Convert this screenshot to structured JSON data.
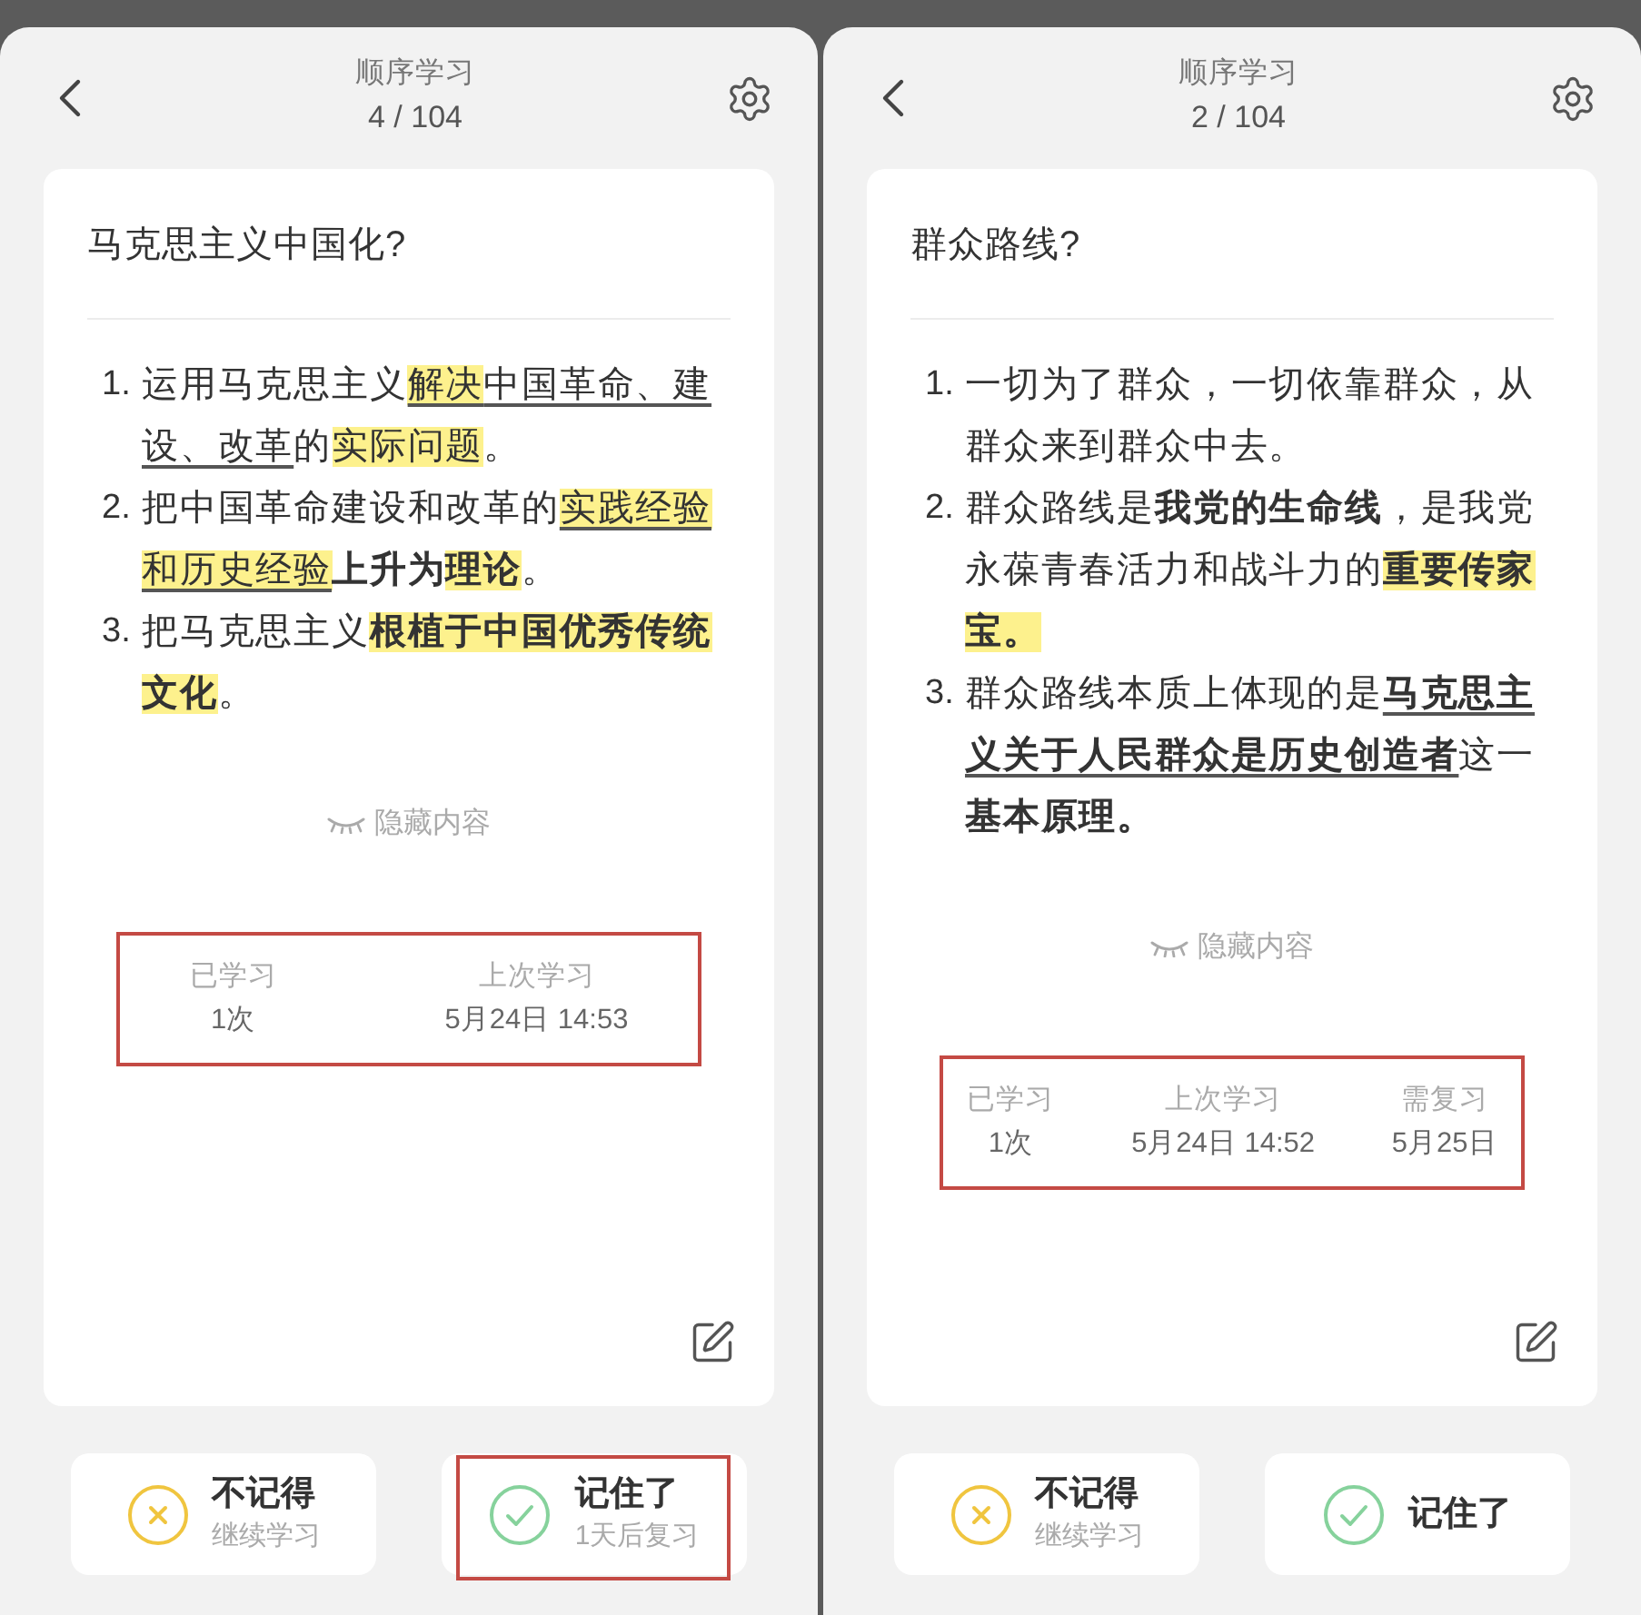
{
  "panels": [
    {
      "header": {
        "title": "顺序学习",
        "counter": "4 / 104"
      },
      "card": {
        "question": "马克思主义中国化?",
        "answer": [
          {
            "number": "1.",
            "segments": [
              {
                "text": "运用马克思主义",
                "bold": false,
                "highlight": false,
                "underline": false
              },
              {
                "text": "解决",
                "bold": false,
                "highlight": true,
                "underline": true
              },
              {
                "text": "中国革命、建设、改革",
                "bold": false,
                "highlight": false,
                "underline": true
              },
              {
                "text": "的",
                "bold": false,
                "highlight": false,
                "underline": false
              },
              {
                "text": "实际问题",
                "bold": false,
                "highlight": true,
                "underline": false
              },
              {
                "text": "。",
                "bold": false,
                "highlight": false,
                "underline": false
              }
            ]
          },
          {
            "number": "2.",
            "segments": [
              {
                "text": "把中国革命建设和改革的",
                "bold": false,
                "highlight": false,
                "underline": false
              },
              {
                "text": "实践经验和历史经验",
                "bold": false,
                "highlight": true,
                "underline": true
              },
              {
                "text": "上升为",
                "bold": true,
                "highlight": false,
                "underline": false
              },
              {
                "text": "理论",
                "bold": true,
                "highlight": true,
                "underline": false
              },
              {
                "text": "。",
                "bold": false,
                "highlight": false,
                "underline": false
              }
            ]
          },
          {
            "number": "3.",
            "segments": [
              {
                "text": "把马克思主义",
                "bold": false,
                "highlight": false,
                "underline": false
              },
              {
                "text": "根植于中国优秀传统文化",
                "bold": true,
                "highlight": true,
                "underline": false
              },
              {
                "text": "。",
                "bold": false,
                "highlight": false,
                "underline": false
              }
            ]
          }
        ],
        "toggle": "隐藏内容",
        "stats": {
          "framed": true,
          "items": [
            {
              "label": "已学习",
              "value": "1次"
            },
            {
              "label": "上次学习",
              "value": "5月24日 14:53"
            }
          ]
        }
      },
      "actions": [
        {
          "kind": "forget",
          "label": "不记得",
          "hint": "继续学习",
          "framed": false
        },
        {
          "kind": "remember",
          "label": "记住了",
          "hint": "1天后复习",
          "framed": true
        }
      ]
    },
    {
      "header": {
        "title": "顺序学习",
        "counter": "2 / 104"
      },
      "card": {
        "question": "群众路线?",
        "answer": [
          {
            "number": "1.",
            "segments": [
              {
                "text": "一切为了群众，一切依靠群众，从群众来到群众中去。",
                "bold": false,
                "highlight": false,
                "underline": false
              }
            ]
          },
          {
            "number": "2.",
            "segments": [
              {
                "text": "群众路线是",
                "bold": false,
                "highlight": false,
                "underline": false
              },
              {
                "text": "我党的生命线",
                "bold": true,
                "highlight": false,
                "underline": false
              },
              {
                "text": "，是我党永葆青春活力和战斗力的",
                "bold": false,
                "highlight": false,
                "underline": false
              },
              {
                "text": "重要传家宝。",
                "bold": true,
                "highlight": true,
                "underline": false
              }
            ]
          },
          {
            "number": "3.",
            "segments": [
              {
                "text": "群众路线本质上体现的是",
                "bold": false,
                "highlight": false,
                "underline": false
              },
              {
                "text": "马克思主义关于人民群众是历史创造者",
                "bold": true,
                "highlight": false,
                "underline": true
              },
              {
                "text": "这一",
                "bold": false,
                "highlight": false,
                "underline": false
              },
              {
                "text": "基本原理。",
                "bold": true,
                "highlight": false,
                "underline": false
              }
            ]
          }
        ],
        "toggle": "隐藏内容",
        "stats": {
          "framed": true,
          "items": [
            {
              "label": "已学习",
              "value": "1次"
            },
            {
              "label": "上次学习",
              "value": "5月24日 14:52"
            },
            {
              "label": "需复习",
              "value": "5月25日"
            }
          ]
        }
      },
      "actions": [
        {
          "kind": "forget",
          "label": "不记得",
          "hint": "继续学习",
          "framed": false
        },
        {
          "kind": "remember",
          "label": "记住了",
          "framed": false
        }
      ]
    }
  ]
}
